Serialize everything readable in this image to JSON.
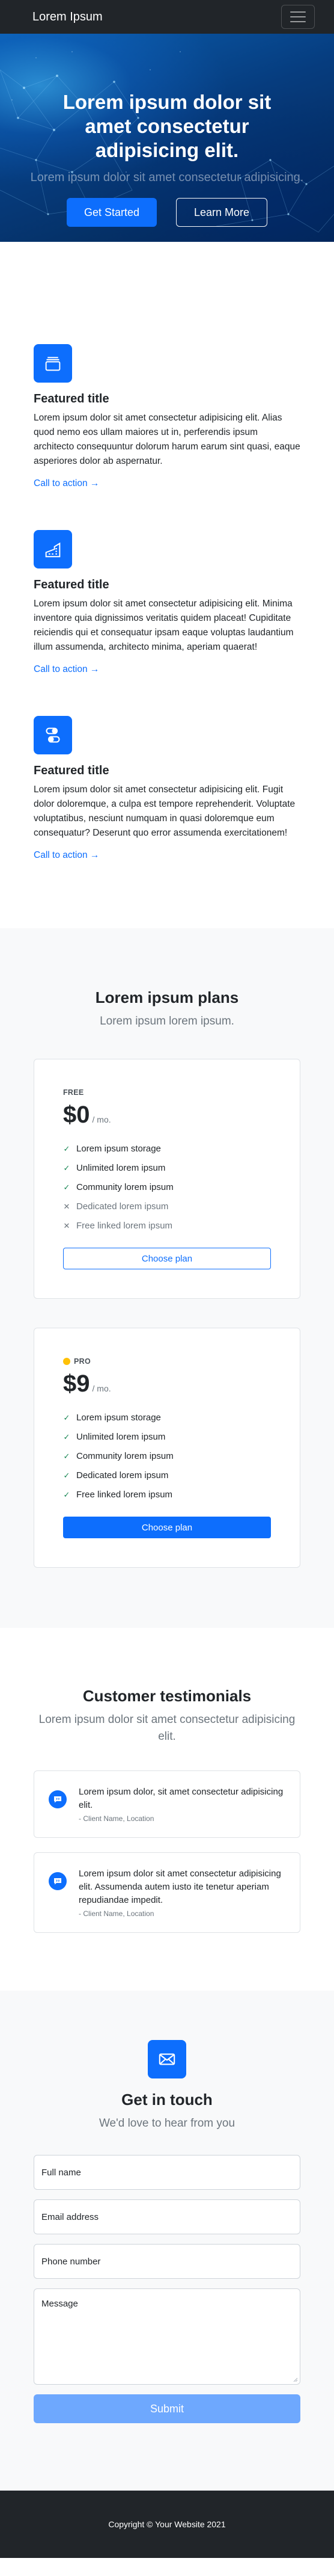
{
  "navbar": {
    "brand": "Lorem Ipsum",
    "toggler_icon": "hamburger-icon"
  },
  "hero": {
    "title": "Lorem ipsum dolor sit amet consectetur adipisicing elit.",
    "subtitle": "Lorem ipsum dolor sit amet consectetur adipisicing.",
    "primary_button": "Get Started",
    "secondary_button": "Learn More"
  },
  "features": [
    {
      "icon": "collection-icon",
      "title": "Featured title",
      "text": "Lorem ipsum dolor sit amet consectetur adipisicing elit. Alias quod nemo eos ullam maiores ut in, perferendis ipsum architecto consequuntur dolorum harum earum sint quasi, eaque asperiores dolor ab aspernatur.",
      "link": "Call to action →"
    },
    {
      "icon": "building-icon",
      "title": "Featured title",
      "text": "Lorem ipsum dolor sit amet consectetur adipisicing elit. Minima inventore quia dignissimos veritatis quidem placeat! Cupiditate reiciendis qui et consequatur ipsam eaque voluptas laudantium illum assumenda, architecto minima, aperiam quaerat!",
      "link": "Call to action →"
    },
    {
      "icon": "toggles-icon",
      "title": "Featured title",
      "text": "Lorem ipsum dolor sit amet consectetur adipisicing elit. Fugit dolor doloremque, a culpa est tempore reprehenderit. Voluptate voluptatibus, nesciunt numquam in quasi doloremque eum consequatur? Deserunt quo error assumenda exercitationem!",
      "link": "Call to action →"
    }
  ],
  "pricing": {
    "title": "Lorem ipsum plans",
    "subtitle": "Lorem ipsum lorem ipsum.",
    "plans": [
      {
        "tier": "FREE",
        "price": "$0",
        "period": "/ mo.",
        "features": [
          {
            "label": "Lorem ipsum storage",
            "included": true
          },
          {
            "label": "Unlimited lorem ipsum",
            "included": true
          },
          {
            "label": "Community lorem ipsum",
            "included": true
          },
          {
            "label": "Dedicated lorem ipsum",
            "included": false
          },
          {
            "label": "Free linked lorem ipsum",
            "included": false
          }
        ],
        "button": "Choose plan"
      },
      {
        "tier": "PRO",
        "price": "$9",
        "period": "/ mo.",
        "features": [
          {
            "label": "Lorem ipsum storage",
            "included": true
          },
          {
            "label": "Unlimited lorem ipsum",
            "included": true
          },
          {
            "label": "Community lorem ipsum",
            "included": true
          },
          {
            "label": "Dedicated lorem ipsum",
            "included": true
          },
          {
            "label": "Free linked lorem ipsum",
            "included": true
          }
        ],
        "button": "Choose plan"
      }
    ]
  },
  "testimonials": {
    "title": "Customer testimonials",
    "subtitle": "Lorem ipsum dolor sit amet consectetur adipisicing elit.",
    "items": [
      {
        "text": "Lorem ipsum dolor, sit amet consectetur adipisicing elit.",
        "author": "- Client Name, Location"
      },
      {
        "text": "Lorem ipsum dolor sit amet consectetur adipisicing elit. Assumenda autem iusto ite tenetur aperiam repudiandae impedit.",
        "author": "- Client Name, Location"
      }
    ]
  },
  "contact": {
    "title": "Get in touch",
    "subtitle": "We'd love to hear from you",
    "fields": {
      "name": "Full name",
      "email": "Email address",
      "phone": "Phone number",
      "message": "Message"
    },
    "submit": "Submit"
  },
  "footer": {
    "copyright": "Copyright © Your Website 2021"
  },
  "colors": {
    "primary": "#0d6efd",
    "dark": "#212529",
    "light_bg": "#f8f9fa",
    "muted": "#6c757d",
    "success": "#198754"
  }
}
